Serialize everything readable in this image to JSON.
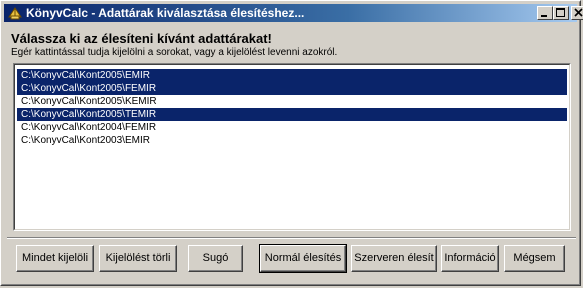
{
  "window": {
    "title": "KönyvCalc - Adattárak kiválasztása élesítéshez...",
    "app_icon": "konyvcalc-app-icon",
    "controls": [
      "minimize-icon",
      "maximize-icon",
      "close-icon"
    ]
  },
  "main": {
    "heading": "Válassza ki az élesíteni kívánt adattárakat!",
    "instruction": "Egér kattintással tudja kijelölni a sorokat, vagy a kijelölést levenni azokról."
  },
  "list": {
    "items": [
      {
        "label": "C:\\KonyvCal\\Kont2005\\EMIR",
        "selected": true
      },
      {
        "label": "C:\\KonyvCal\\Kont2005\\FEMIR",
        "selected": true
      },
      {
        "label": "C:\\KonyvCal\\Kont2005\\KEMIR",
        "selected": false
      },
      {
        "label": "C:\\KonyvCal\\Kont2005\\TEMIR",
        "selected": true
      },
      {
        "label": "C:\\KonyvCal\\Kont2004\\FEMIR",
        "selected": false
      },
      {
        "label": "C:\\KonyvCal\\Kont2003\\EMIR",
        "selected": false
      }
    ]
  },
  "buttons": {
    "select_all": "Mindet kijelöli",
    "clear_selection": "Kijelölést törli",
    "help": "Sugó",
    "normal_activate": "Normál élesítés",
    "server_activate": "Szerveren élesít",
    "info": "Információ",
    "cancel": "Mégsem"
  },
  "colors": {
    "titlebar_start": "#0a246a",
    "titlebar_end": "#a6caf0",
    "selection": "#0a246a",
    "face": "#d4d0c8"
  }
}
